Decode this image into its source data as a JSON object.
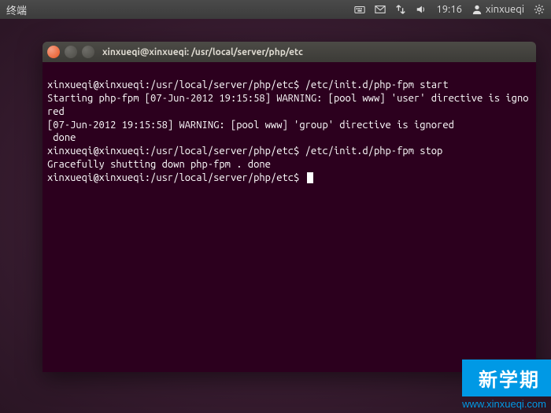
{
  "menubar": {
    "app_title": "终端",
    "time": "19:16",
    "username": "xinxueqi"
  },
  "terminal": {
    "title": "xinxueqi@xinxueqi: /usr/local/server/php/etc",
    "lines": [
      "xinxueqi@xinxueqi:/usr/local/server/php/etc$ /etc/init.d/php-fpm start",
      "Starting php-fpm [07-Jun-2012 19:15:58] WARNING: [pool www] 'user' directive is ignored",
      "[07-Jun-2012 19:15:58] WARNING: [pool www] 'group' directive is ignored",
      " done",
      "xinxueqi@xinxueqi:/usr/local/server/php/etc$ /etc/init.d/php-fpm stop",
      "Gracefully shutting down php-fpm . done",
      "xinxueqi@xinxueqi:/usr/local/server/php/etc$ "
    ]
  },
  "watermark": {
    "banner": "新学期",
    "url": "www.xinxueqi.com"
  }
}
